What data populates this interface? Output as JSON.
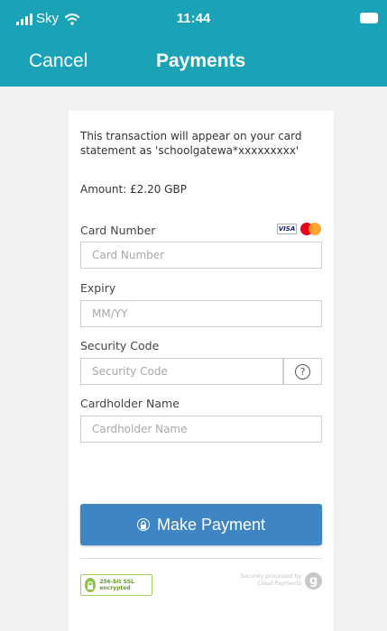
{
  "status_bar": {
    "carrier": "Sky",
    "time": "11:44"
  },
  "nav": {
    "cancel_label": "Cancel",
    "title": "Payments"
  },
  "form": {
    "notice": "This transaction will appear on your card statement as 'schoolgatewa*xxxxxxxxx'",
    "amount": "Amount: £2.20 GBP",
    "card_number": {
      "label": "Card Number",
      "placeholder": "Card Number",
      "logos": [
        "VISA",
        "mastercard"
      ]
    },
    "expiry": {
      "label": "Expiry",
      "placeholder": "MM/YY"
    },
    "security_code": {
      "label": "Security Code",
      "placeholder": "Security Code",
      "help": "?"
    },
    "cardholder": {
      "label": "Cardholder Name",
      "placeholder": "Cardholder Name"
    },
    "submit_label": "Make Payment"
  },
  "footer": {
    "ssl_badge": "256-bit SSL encrypted",
    "secured_text": "Securely processed by Cloud Payments",
    "logo_letter": "g"
  },
  "colors": {
    "header": "#1aa3b6",
    "button": "#3e86c3",
    "background": "#f1f1f1"
  }
}
